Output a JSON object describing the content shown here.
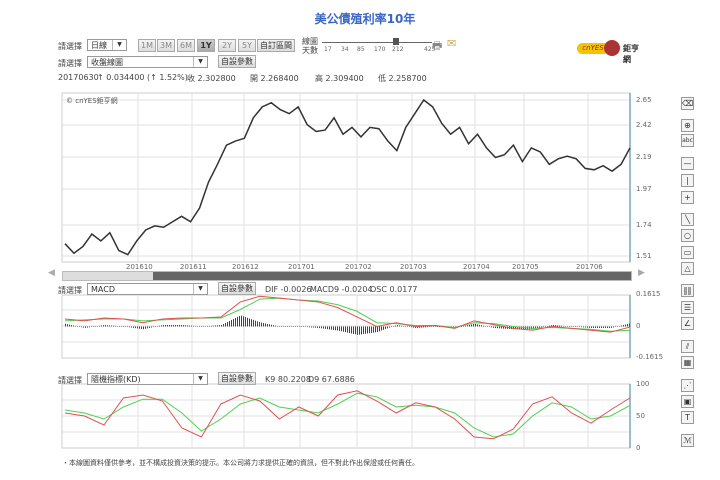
{
  "title": "美公債殖利率10年",
  "row1": {
    "label": "請選擇",
    "period": "日線",
    "ranges": [
      "1M",
      "3M",
      "6M",
      "1Y",
      "2Y",
      "5Y"
    ],
    "active_range": "1Y",
    "custom_range": "自訂區間",
    "ma_label1": "線圖",
    "ma_label2": "天數",
    "ma_days": [
      "17",
      "34",
      "85",
      "170",
      "212",
      "425"
    ]
  },
  "row2": {
    "label": "請選擇",
    "chart_type": "收盤線圖",
    "params": "自設參數"
  },
  "quote": {
    "date": "20170630",
    "change": "↑ 0.034400 (↑ 1.52%)",
    "close": "收 2.302800",
    "open": "開 2.268400",
    "high": "高 2.309400",
    "low": "低 2.258700"
  },
  "logo": {
    "text": "cnYES 鉅亨網"
  },
  "main": {
    "watermark": "© cnYES鉅亨網",
    "y_ticks": [
      "2.65",
      "2.42",
      "2.19",
      "1.97",
      "1.74",
      "1.51"
    ],
    "x_ticks": [
      "201610",
      "201611",
      "201612",
      "201701",
      "201702",
      "201703",
      "201704",
      "201705",
      "201706"
    ]
  },
  "macd": {
    "label": "請選擇",
    "indicator": "MACD",
    "params": "自設參數",
    "dif": "DIF -0.0026",
    "macd9": "MACD9 -0.0204",
    "osc": "OSC 0.0177",
    "y_ticks": [
      "0.1615",
      "0",
      "-0.1615"
    ]
  },
  "kd": {
    "label": "請選擇",
    "indicator": "隨機指標(KD)",
    "params": "自設參數",
    "k9": "K9 80.2208",
    "d9": "D9 67.6886",
    "y_ticks": [
      "100",
      "50",
      "0"
    ]
  },
  "disclaimer": "・本線圖資料僅供參考，並不構成投資決策的提示。本公司將力求提供正確的資訊，但不對此作出保證或任何責任。",
  "toolbar": [
    "eraser",
    "zoom-in",
    "text",
    "horizontal-line",
    "vertical-line",
    "crosshair",
    "trend-line",
    "ellipse",
    "rectangle",
    "triangle",
    "vertical-lines",
    "horizontal-lines",
    "fan",
    "speed-lines",
    "grid",
    "gann-fan",
    "note",
    "text-box",
    "fibonacci"
  ],
  "colors": {
    "price": "#333333",
    "dif": "#e05050",
    "macd9": "#50d050",
    "osc": "#3030e0",
    "title": "#3a66c4"
  },
  "chart_data": [
    {
      "type": "line",
      "title": "美公債殖利率10年",
      "ylim": [
        1.51,
        2.65
      ],
      "series": [
        {
          "name": "收盤",
          "values": [
            1.6,
            1.53,
            1.58,
            1.67,
            1.62,
            1.68,
            1.55,
            1.52,
            1.62,
            1.7,
            1.73,
            1.72,
            1.76,
            1.8,
            1.76,
            1.86,
            2.05,
            2.18,
            2.32,
            2.35,
            2.37,
            2.52,
            2.6,
            2.63,
            2.58,
            2.55,
            2.6,
            2.47,
            2.42,
            2.43,
            2.52,
            2.4,
            2.45,
            2.38,
            2.45,
            2.44,
            2.35,
            2.28,
            2.45,
            2.55,
            2.65,
            2.6,
            2.48,
            2.4,
            2.45,
            2.33,
            2.4,
            2.3,
            2.23,
            2.25,
            2.32,
            2.2,
            2.3,
            2.27,
            2.18,
            2.22,
            2.24,
            2.22,
            2.15,
            2.14,
            2.17,
            2.13,
            2.18,
            2.3
          ]
        }
      ]
    },
    {
      "type": "line",
      "title": "MACD",
      "ylim": [
        -0.1615,
        0.1615
      ],
      "series": [
        {
          "name": "DIF",
          "values": [
            0.04,
            0.03,
            0.045,
            0.04,
            0.02,
            0.04,
            0.045,
            0.045,
            0.05,
            0.13,
            0.16,
            0.15,
            0.14,
            0.13,
            0.1,
            0.05,
            0.0,
            0.02,
            0.0,
            0.005,
            -0.01,
            0.03,
            0.01,
            -0.01,
            -0.02,
            0.0,
            -0.01,
            -0.02,
            -0.03,
            -0.003
          ]
        },
        {
          "name": "MACD9",
          "values": [
            0.03,
            0.035,
            0.04,
            0.04,
            0.03,
            0.035,
            0.04,
            0.045,
            0.045,
            0.09,
            0.145,
            0.15,
            0.14,
            0.135,
            0.115,
            0.08,
            0.02,
            0.015,
            0.005,
            0.005,
            -0.005,
            0.02,
            0.015,
            0.0,
            -0.01,
            -0.005,
            -0.01,
            -0.015,
            -0.025,
            -0.02
          ]
        },
        {
          "name": "OSC",
          "values": [
            0.015,
            -0.008,
            0.008,
            0,
            -0.015,
            0.008,
            0.008,
            0,
            0.008,
            0.06,
            0.022,
            0,
            0,
            -0.008,
            -0.022,
            -0.045,
            -0.03,
            0.008,
            -0.008,
            0,
            -0.008,
            0.015,
            -0.008,
            -0.015,
            -0.015,
            0.008,
            0,
            -0.008,
            -0.008,
            0.017
          ]
        }
      ]
    },
    {
      "type": "line",
      "title": "隨機指標(KD)",
      "ylim": [
        0,
        100
      ],
      "series": [
        {
          "name": "K9",
          "values": [
            55,
            50,
            35,
            80,
            85,
            75,
            30,
            15,
            70,
            85,
            75,
            45,
            65,
            50,
            85,
            92,
            75,
            55,
            72,
            65,
            45,
            15,
            12,
            28,
            70,
            82,
            55,
            38,
            60,
            80.22
          ]
        },
        {
          "name": "D9",
          "values": [
            60,
            55,
            45,
            65,
            78,
            78,
            55,
            25,
            45,
            70,
            80,
            65,
            60,
            55,
            70,
            88,
            82,
            65,
            68,
            65,
            55,
            30,
            15,
            20,
            50,
            72,
            65,
            45,
            50,
            67.69
          ]
        }
      ]
    }
  ]
}
